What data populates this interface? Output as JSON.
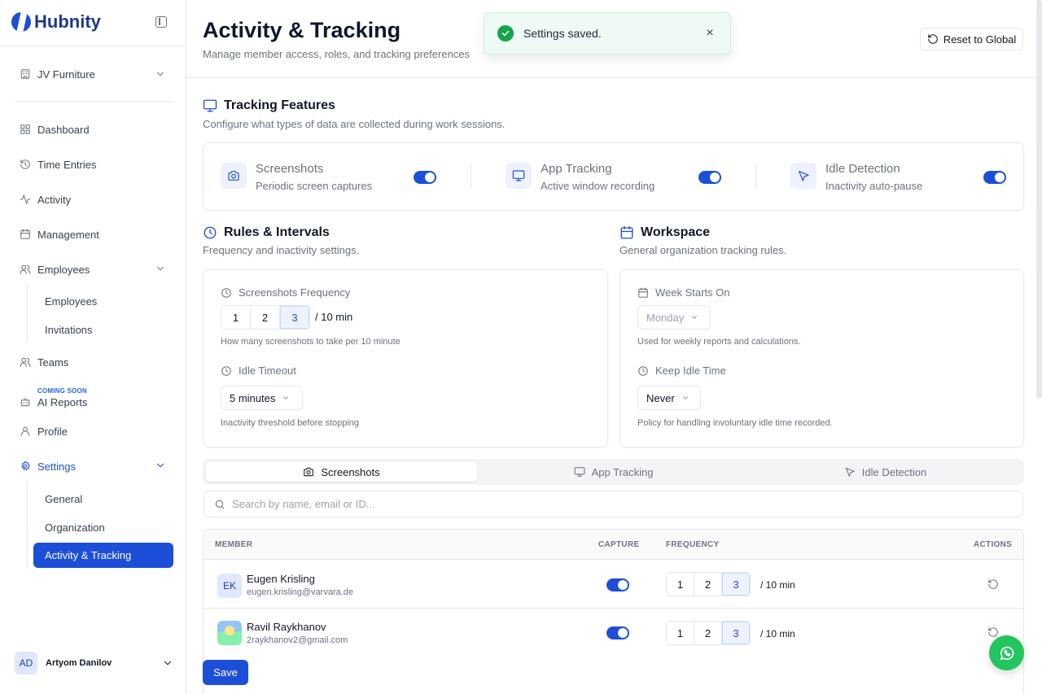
{
  "brand": {
    "name": "Hubnity"
  },
  "sidebar": {
    "organization": "JV Furniture",
    "items": [
      {
        "label": "Dashboard"
      },
      {
        "label": "Time Entries"
      },
      {
        "label": "Activity"
      },
      {
        "label": "Management"
      },
      {
        "label": "Employees"
      },
      {
        "label": "Teams"
      },
      {
        "label": "AI Reports",
        "badge": "COMING SOON"
      },
      {
        "label": "Profile"
      },
      {
        "label": "Settings"
      }
    ],
    "employees_sub": [
      "Employees",
      "Invitations"
    ],
    "settings_sub": [
      "General",
      "Organization",
      "Activity & Tracking"
    ],
    "user": {
      "initials": "AD",
      "name": "Artyom Danilov"
    }
  },
  "header": {
    "title": "Activity & Tracking",
    "subtitle": "Manage member access, roles, and tracking preferences",
    "reset_label": "Reset to Global"
  },
  "toast": {
    "message": "Settings saved.",
    "close": "×"
  },
  "tracking_features": {
    "title": "Tracking Features",
    "subtitle": "Configure what types of data are collected during work sessions.",
    "features": [
      {
        "name": "Screenshots",
        "desc": "Periodic screen captures",
        "enabled": true,
        "icon": "camera-icon"
      },
      {
        "name": "App Tracking",
        "desc": "Active window recording",
        "enabled": true,
        "icon": "monitor-icon"
      },
      {
        "name": "Idle Detection",
        "desc": "Inactivity auto-pause",
        "enabled": true,
        "icon": "cursor-icon"
      }
    ]
  },
  "rules": {
    "title": "Rules & Intervals",
    "subtitle": "Frequency and inactivity settings.",
    "freq_label": "Screenshots Frequency",
    "freq_options": [
      "1",
      "2",
      "3"
    ],
    "freq_selected": "3",
    "freq_per": "/  10 min",
    "freq_help": "How many screenshots to take per 10 minute",
    "idle_label": "Idle Timeout",
    "idle_value": "5 minutes",
    "idle_help": "Inactivity threshold before stopping"
  },
  "workspace": {
    "title": "Workspace",
    "subtitle": "General organization tracking rules.",
    "week_label": "Week Starts On",
    "week_value": "Monday",
    "week_help": "Used for weekly reports and calculations.",
    "keep_label": "Keep Idle Time",
    "keep_value": "Never",
    "keep_help": "Policy for handling involuntary idle time recorded."
  },
  "tabs": [
    {
      "label": "Screenshots",
      "active": true
    },
    {
      "label": "App Tracking",
      "active": false
    },
    {
      "label": "Idle Detection",
      "active": false
    }
  ],
  "search": {
    "placeholder": "Search by name, email or ID..."
  },
  "table": {
    "headers": [
      "MEMBER",
      "CAPTURE",
      "FREQUENCY",
      "ACTIONS"
    ],
    "rows": [
      {
        "initials": "EK",
        "name": "Eugen Krisling",
        "email": "eugen.krisling@varvara.de",
        "capture": true,
        "freq_selected": "3",
        "per": "/  10 min"
      },
      {
        "initials": "",
        "name": "Ravil Raykhanov",
        "email": "2raykhanov2@gmail.com",
        "capture": true,
        "freq_selected": "3",
        "per": "/  10 min"
      }
    ]
  },
  "save_label": "Save",
  "colors": {
    "accent": "#1d4ed8",
    "success": "#16a34a",
    "whatsapp": "#22c55e"
  }
}
